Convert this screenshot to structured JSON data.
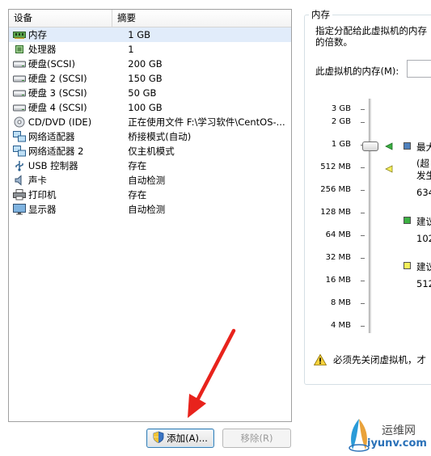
{
  "devices": {
    "header": {
      "device": "设备",
      "summary": "摘要"
    },
    "rows": [
      {
        "icon": "memory-icon",
        "name": "内存",
        "summary": "1 GB"
      },
      {
        "icon": "processor-icon",
        "name": "处理器",
        "summary": "1"
      },
      {
        "icon": "hard-disk-icon",
        "name": "硬盘(SCSI)",
        "summary": "200 GB"
      },
      {
        "icon": "hard-disk-icon",
        "name": "硬盘 2 (SCSI)",
        "summary": "150 GB"
      },
      {
        "icon": "hard-disk-icon",
        "name": "硬盘 3 (SCSI)",
        "summary": "50 GB"
      },
      {
        "icon": "hard-disk-icon",
        "name": "硬盘 4 (SCSI)",
        "summary": "100 GB"
      },
      {
        "icon": "cd-dvd-icon",
        "name": "CD/DVD (IDE)",
        "summary": "正在使用文件 F:\\学习软件\\CentOS-..."
      },
      {
        "icon": "network-adapter-icon",
        "name": "网络适配器",
        "summary": "桥接模式(自动)"
      },
      {
        "icon": "network-adapter-icon",
        "name": "网络适配器 2",
        "summary": "仅主机模式"
      },
      {
        "icon": "usb-icon",
        "name": "USB 控制器",
        "summary": "存在"
      },
      {
        "icon": "sound-card-icon",
        "name": "声卡",
        "summary": "自动检测"
      },
      {
        "icon": "printer-icon",
        "name": "打印机",
        "summary": "存在"
      },
      {
        "icon": "display-icon",
        "name": "显示器",
        "summary": "自动检测"
      }
    ],
    "selected_index": 0
  },
  "buttons": {
    "add": "添加(A)...",
    "remove": "移除(R)"
  },
  "memory": {
    "title": "内存",
    "description_line1": "指定分配给此虚拟机的内存",
    "description_line2": "的倍数。",
    "input_label": "此虚拟机的内存(M):",
    "input_value": "",
    "scale_labels": [
      "3 GB",
      "2 GB",
      "1 GB",
      "512 MB",
      "256 MB",
      "128 MB",
      "64 MB",
      "32 MB",
      "16 MB",
      "8 MB",
      "4 MB"
    ],
    "slider_value": "1 GB",
    "legend": {
      "max": {
        "color": "#4f81bd",
        "label": "最大",
        "line2": "(超",
        "line3": "发生",
        "value": "634"
      },
      "recommended": {
        "color": "#3cb043",
        "label": "建议",
        "value": "102"
      },
      "min_recommended": {
        "color": "#f5f05a",
        "label": "建议",
        "value": "512"
      }
    },
    "warning": "必须先关闭虚拟机，才"
  },
  "watermark": {
    "cn": "运维网",
    "en": "iyunv.com"
  },
  "colors": {
    "selection": "#e1ecfa",
    "annotation_arrow": "#e8231c"
  }
}
